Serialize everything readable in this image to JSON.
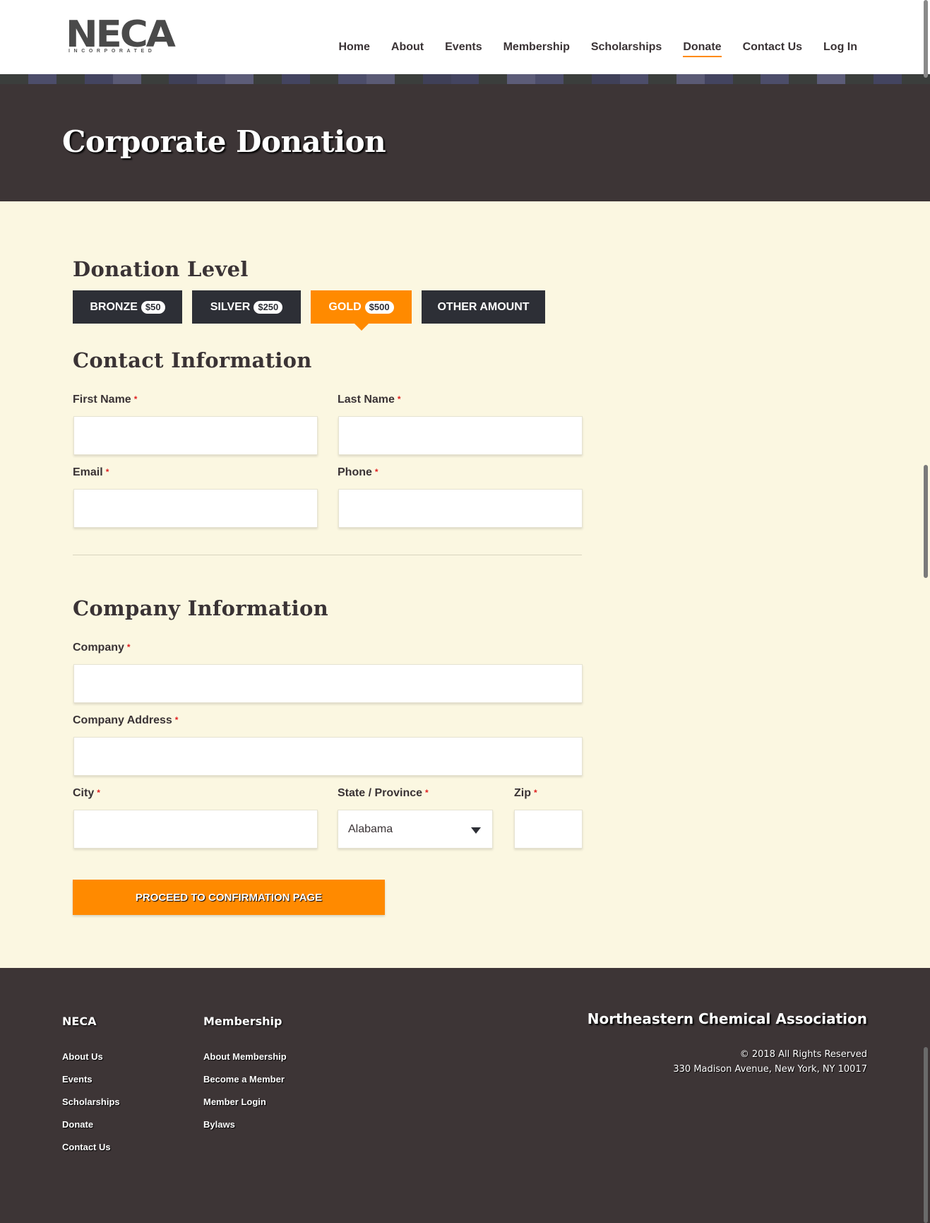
{
  "logo": {
    "word": "NECA",
    "sub": "INCORPORATED"
  },
  "nav": {
    "items": [
      {
        "label": "Home"
      },
      {
        "label": "About"
      },
      {
        "label": "Events"
      },
      {
        "label": "Membership"
      },
      {
        "label": "Scholarships"
      },
      {
        "label": "Donate",
        "active": true
      },
      {
        "label": "Contact Us"
      },
      {
        "label": "Log In"
      }
    ]
  },
  "page": {
    "title": "Corporate Donation"
  },
  "donation": {
    "heading": "Donation Level",
    "levels": [
      {
        "label": "BRONZE",
        "amount": "$50"
      },
      {
        "label": "SILVER",
        "amount": "$250"
      },
      {
        "label": "GOLD",
        "amount": "$500",
        "selected": true
      },
      {
        "label": "OTHER AMOUNT"
      }
    ]
  },
  "contact": {
    "heading": "Contact Information",
    "first_name": "First Name",
    "last_name": "Last Name",
    "email": "Email",
    "phone": "Phone"
  },
  "company": {
    "heading": "Company Information",
    "company": "Company",
    "address": "Company Address",
    "city": "City",
    "state": "State / Province",
    "state_value": "Alabama",
    "zip": "Zip"
  },
  "required_mark": "*",
  "submit": {
    "label": "PROCEED TO CONFIRMATION PAGE"
  },
  "footer": {
    "neca": {
      "heading": "NECA",
      "links": [
        "About Us",
        "Events",
        "Scholarships",
        "Donate",
        "Contact Us"
      ]
    },
    "membership": {
      "heading": "Membership",
      "links": [
        "About Membership",
        "Become a Member",
        "Member Login",
        "Bylaws"
      ]
    },
    "org_name": "Northeastern Chemical Association",
    "copyright": "© 2018 All Rights Reserved",
    "address": "330 Madison Avenue, New York, NY 10017"
  },
  "colors": {
    "accent": "#ff8a00",
    "dark": "#3d3536",
    "button_dark": "#2d2f36",
    "background": "#fbf7e1"
  }
}
